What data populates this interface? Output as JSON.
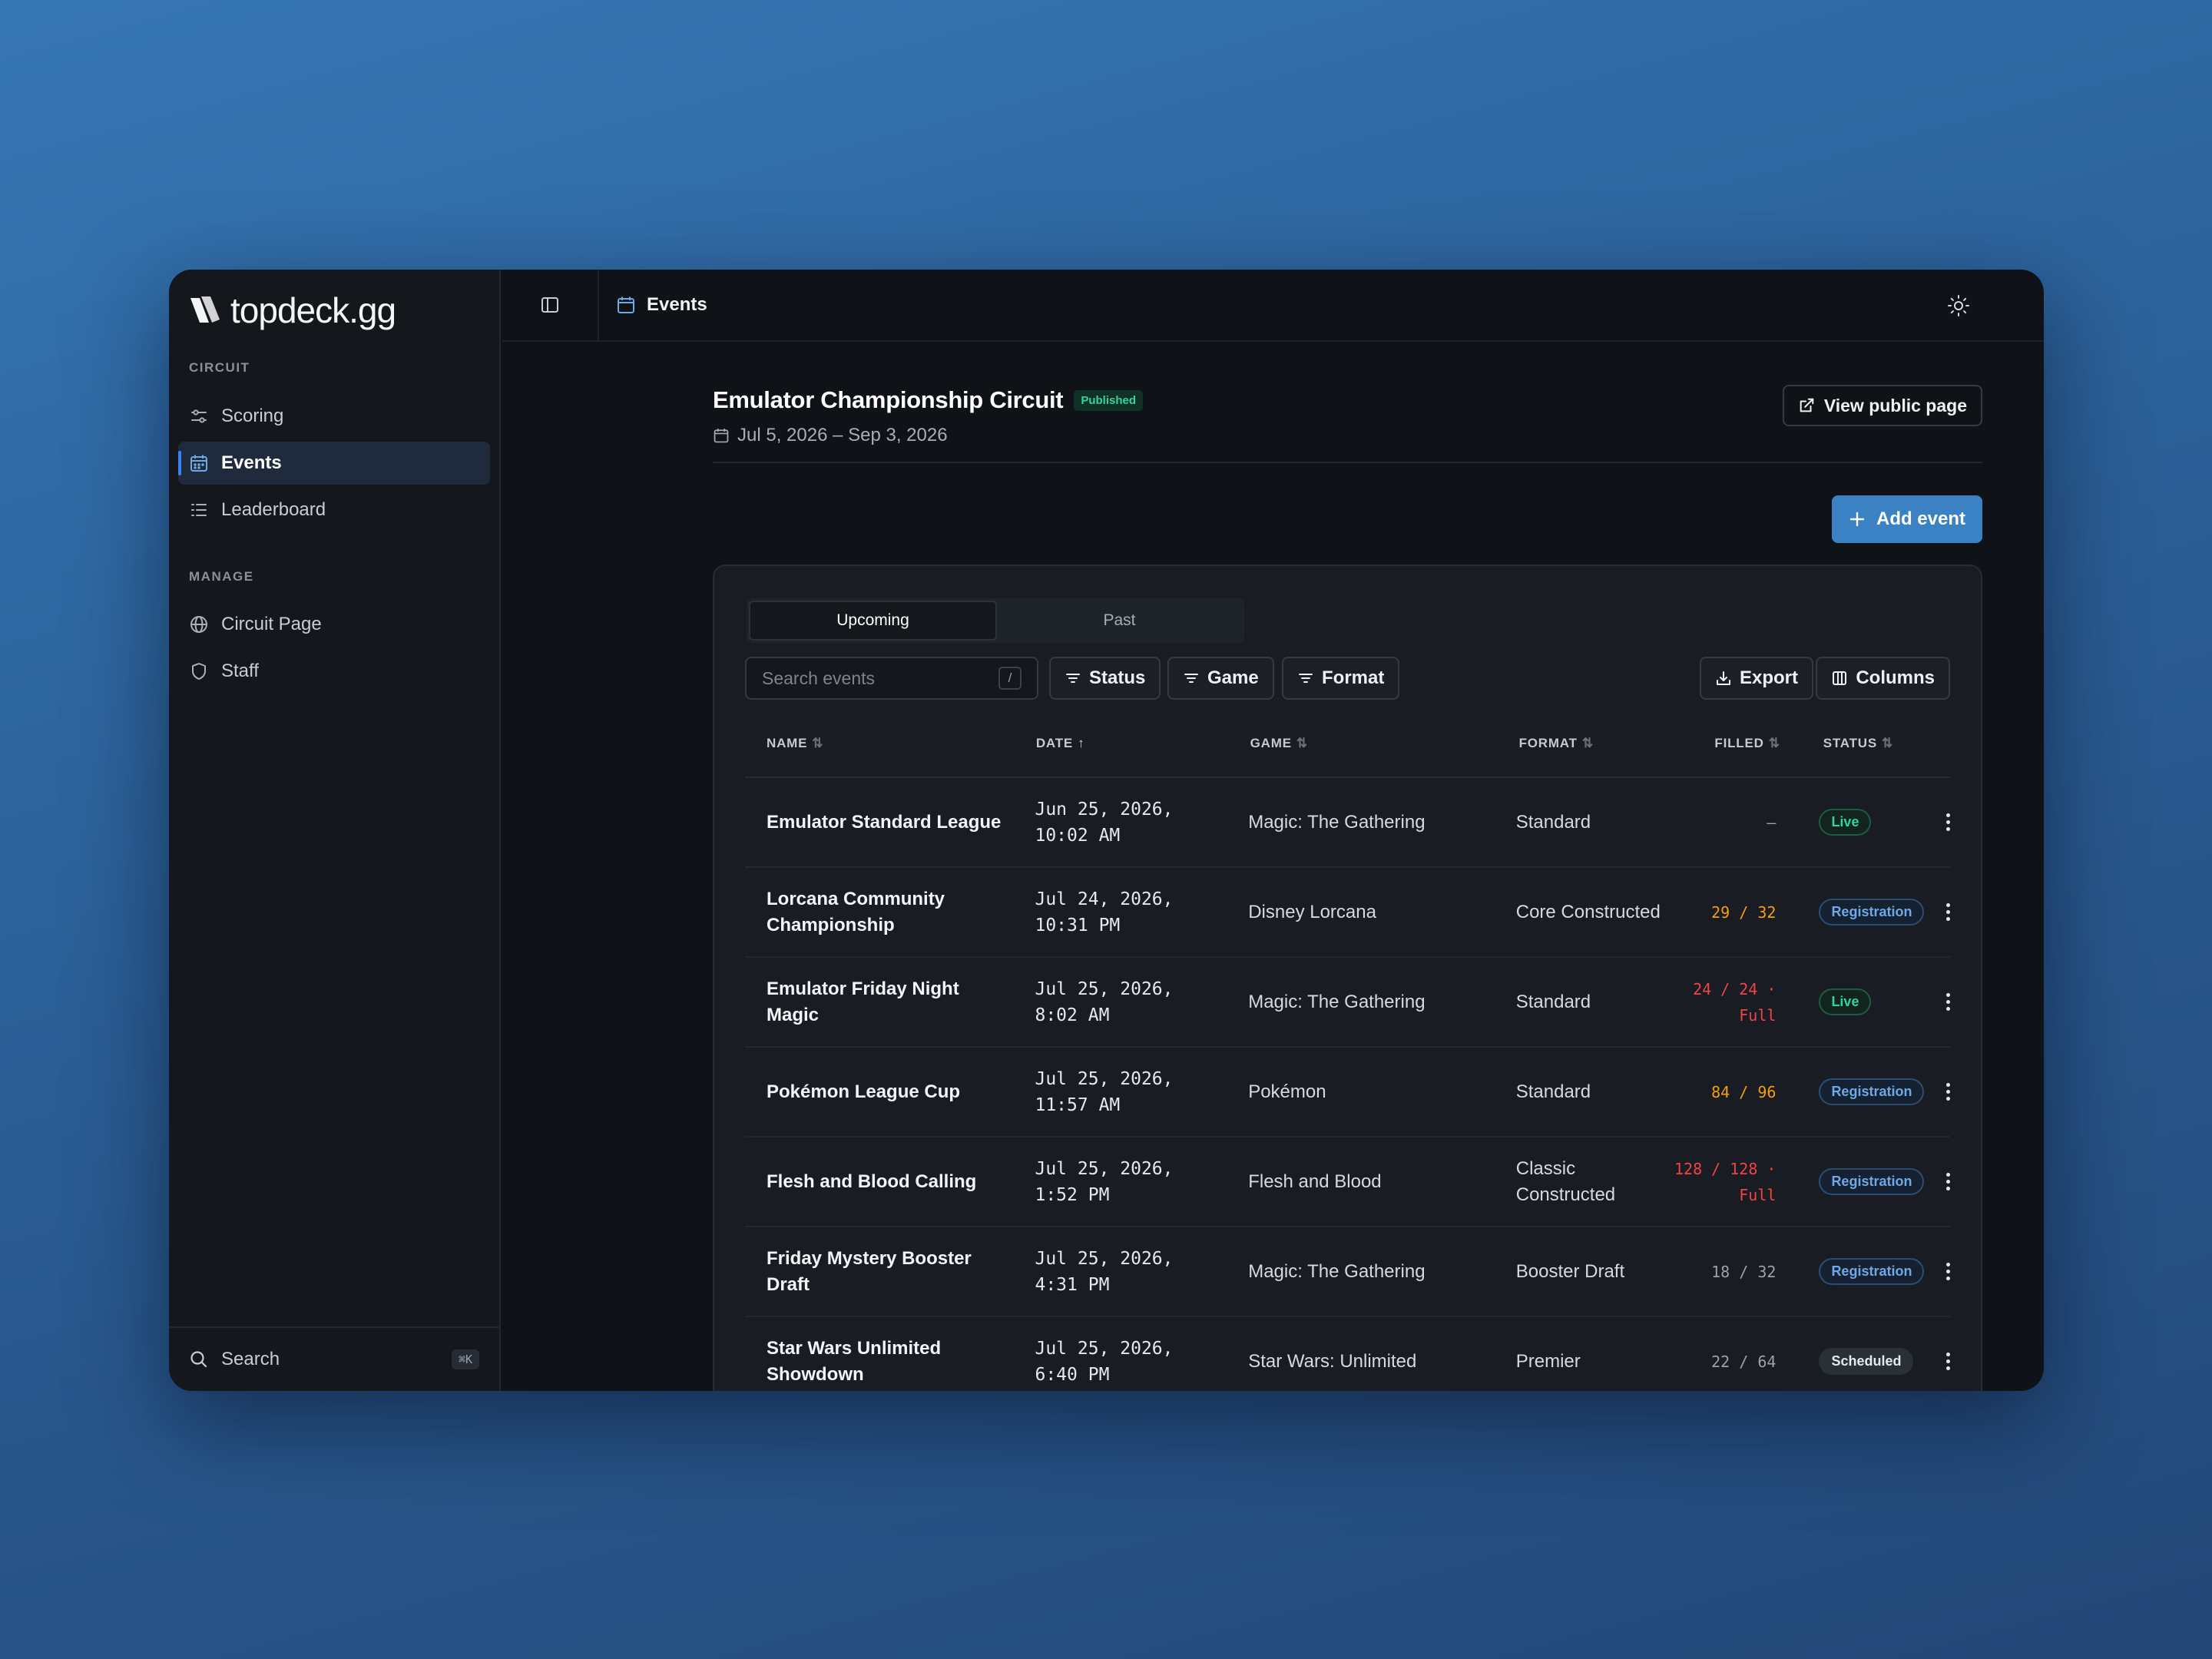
{
  "app": {
    "logo_text": "topdeck.gg"
  },
  "sidebar": {
    "circuit_label": "CIRCUIT",
    "manage_label": "MANAGE",
    "circuit_items": [
      {
        "label": "Scoring",
        "icon": "sliders-icon"
      },
      {
        "label": "Events",
        "icon": "calendar-icon",
        "active": true
      },
      {
        "label": "Leaderboard",
        "icon": "list-icon"
      }
    ],
    "manage_items": [
      {
        "label": "Circuit Page",
        "icon": "globe-icon"
      },
      {
        "label": "Staff",
        "icon": "shield-icon"
      }
    ],
    "search_label": "Search",
    "search_shortcut": "⌘K"
  },
  "header": {
    "breadcrumb": "Events"
  },
  "circuit": {
    "title": "Emulator Championship Circuit",
    "status_badge": "Published",
    "date_range": "Jul 5, 2026 – Sep 3, 2026",
    "view_public_label": "View public page",
    "add_event_label": "Add event"
  },
  "tabs": {
    "upcoming": "Upcoming",
    "past": "Past",
    "active": "upcoming"
  },
  "toolbar": {
    "search_placeholder": "Search events",
    "search_shortcut": "/",
    "status_filter": "Status",
    "game_filter": "Game",
    "format_filter": "Format",
    "export_label": "Export",
    "columns_label": "Columns"
  },
  "table": {
    "headers": {
      "name": "NAME",
      "date": "DATE",
      "game": "GAME",
      "format": "FORMAT",
      "filled": "FILLED",
      "status": "STATUS"
    },
    "rows": [
      {
        "name": "Emulator Standard League",
        "date1": "Jun 25, 2026,",
        "date2": "10:02 AM",
        "game": "Magic: The Gathering",
        "format": "Standard",
        "filled": "–",
        "filled2": "",
        "filled_color": "gray",
        "status": "Live",
        "status_kind": "live"
      },
      {
        "name": "Lorcana Community Championship",
        "date1": "Jul 24, 2026,",
        "date2": "10:31 PM",
        "game": "Disney Lorcana",
        "format": "Core Constructed",
        "filled": "29 / 32",
        "filled2": "",
        "filled_color": "amber",
        "status": "Registration",
        "status_kind": "reg"
      },
      {
        "name": "Emulator Friday Night Magic",
        "date1": "Jul 25, 2026,",
        "date2": "8:02 AM",
        "game": "Magic: The Gathering",
        "format": "Standard",
        "filled": "24 / 24 ·",
        "filled2": "Full",
        "filled_color": "red",
        "status": "Live",
        "status_kind": "live"
      },
      {
        "name": "Pokémon League Cup",
        "date1": "Jul 25, 2026,",
        "date2": "11:57 AM",
        "game": "Pokémon",
        "format": "Standard",
        "filled": "84 / 96",
        "filled2": "",
        "filled_color": "amber",
        "status": "Registration",
        "status_kind": "reg"
      },
      {
        "name": "Flesh and Blood Calling",
        "date1": "Jul 25, 2026,",
        "date2": "1:52 PM",
        "game": "Flesh and Blood",
        "format": "Classic Constructed",
        "filled": "128 / 128 ·",
        "filled2": "Full",
        "filled_color": "red",
        "status": "Registration",
        "status_kind": "reg"
      },
      {
        "name": "Friday Mystery Booster Draft",
        "date1": "Jul 25, 2026,",
        "date2": "4:31 PM",
        "game": "Magic: The Gathering",
        "format": "Booster Draft",
        "filled": "18 / 32",
        "filled2": "",
        "filled_color": "gray",
        "status": "Registration",
        "status_kind": "reg"
      },
      {
        "name": "Star Wars Unlimited Showdown",
        "date1": "Jul 25, 2026,",
        "date2": "6:40 PM",
        "game": "Star Wars: Unlimited",
        "format": "Premier",
        "filled": "22 / 64",
        "filled2": "",
        "filled_color": "gray",
        "status": "Scheduled",
        "status_kind": "sch"
      }
    ]
  },
  "colors": {
    "accent": "#3b82c4",
    "live": "#34d399",
    "registration": "#6ea8e6",
    "amber": "#f59e0b",
    "red": "#ef4444"
  }
}
